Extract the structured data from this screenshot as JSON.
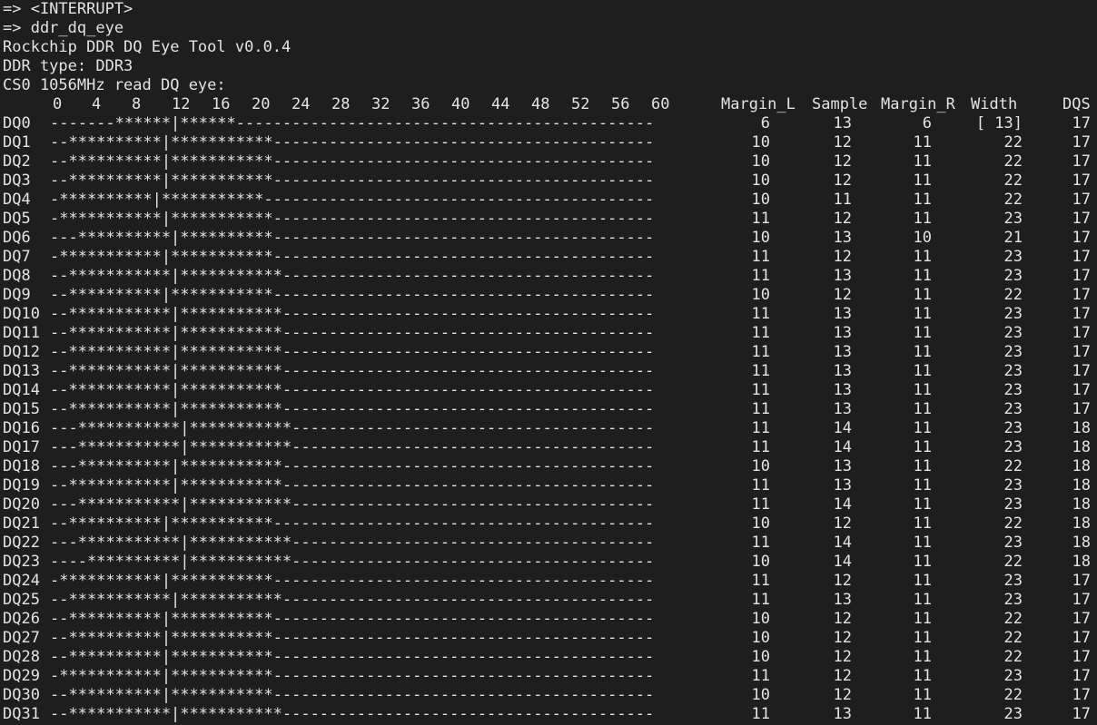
{
  "history": [
    "=> <INTERRUPT>",
    "=> ddr_dq_eye",
    "Rockchip DDR DQ Eye Tool v0.0.4",
    "DDR type: DDR3",
    "CS0 1056MHz read DQ eye:"
  ],
  "scale_ticks": [
    "0",
    "4",
    "8",
    "12",
    "16",
    "20",
    "24",
    "28",
    "32",
    "36",
    "40",
    "44",
    "48",
    "52",
    "56",
    "60"
  ],
  "columns": {
    "margin_l": "Margin_L",
    "sample": "Sample",
    "margin_r": "Margin_R",
    "width": "Width",
    "dqs": "DQS"
  },
  "rows": [
    {
      "name": "DQ0",
      "eye": "-------******|******---------------------------------------------",
      "margin_l": "6",
      "sample": "13",
      "margin_r": "6",
      "width": "[ 13]",
      "dqs": "17"
    },
    {
      "name": "DQ1",
      "eye": "--**********|***********-----------------------------------------",
      "margin_l": "10",
      "sample": "12",
      "margin_r": "11",
      "width": "22",
      "dqs": "17"
    },
    {
      "name": "DQ2",
      "eye": "--**********|***********-----------------------------------------",
      "margin_l": "10",
      "sample": "12",
      "margin_r": "11",
      "width": "22",
      "dqs": "17"
    },
    {
      "name": "DQ3",
      "eye": "--**********|***********-----------------------------------------",
      "margin_l": "10",
      "sample": "12",
      "margin_r": "11",
      "width": "22",
      "dqs": "17"
    },
    {
      "name": "DQ4",
      "eye": "-**********|***********------------------------------------------",
      "margin_l": "10",
      "sample": "11",
      "margin_r": "11",
      "width": "22",
      "dqs": "17"
    },
    {
      "name": "DQ5",
      "eye": "-***********|***********-----------------------------------------",
      "margin_l": "11",
      "sample": "12",
      "margin_r": "11",
      "width": "23",
      "dqs": "17"
    },
    {
      "name": "DQ6",
      "eye": "---**********|**********-----------------------------------------",
      "margin_l": "10",
      "sample": "13",
      "margin_r": "10",
      "width": "21",
      "dqs": "17"
    },
    {
      "name": "DQ7",
      "eye": "-***********|***********-----------------------------------------",
      "margin_l": "11",
      "sample": "12",
      "margin_r": "11",
      "width": "23",
      "dqs": "17"
    },
    {
      "name": "DQ8",
      "eye": "--***********|***********----------------------------------------",
      "margin_l": "11",
      "sample": "13",
      "margin_r": "11",
      "width": "23",
      "dqs": "17"
    },
    {
      "name": "DQ9",
      "eye": "--**********|***********-----------------------------------------",
      "margin_l": "10",
      "sample": "12",
      "margin_r": "11",
      "width": "22",
      "dqs": "17"
    },
    {
      "name": "DQ10",
      "eye": "--***********|***********----------------------------------------",
      "margin_l": "11",
      "sample": "13",
      "margin_r": "11",
      "width": "23",
      "dqs": "17"
    },
    {
      "name": "DQ11",
      "eye": "--***********|***********----------------------------------------",
      "margin_l": "11",
      "sample": "13",
      "margin_r": "11",
      "width": "23",
      "dqs": "17"
    },
    {
      "name": "DQ12",
      "eye": "--***********|***********----------------------------------------",
      "margin_l": "11",
      "sample": "13",
      "margin_r": "11",
      "width": "23",
      "dqs": "17"
    },
    {
      "name": "DQ13",
      "eye": "--***********|***********----------------------------------------",
      "margin_l": "11",
      "sample": "13",
      "margin_r": "11",
      "width": "23",
      "dqs": "17"
    },
    {
      "name": "DQ14",
      "eye": "--***********|***********----------------------------------------",
      "margin_l": "11",
      "sample": "13",
      "margin_r": "11",
      "width": "23",
      "dqs": "17"
    },
    {
      "name": "DQ15",
      "eye": "--***********|***********----------------------------------------",
      "margin_l": "11",
      "sample": "13",
      "margin_r": "11",
      "width": "23",
      "dqs": "17"
    },
    {
      "name": "DQ16",
      "eye": "---***********|***********---------------------------------------",
      "margin_l": "11",
      "sample": "14",
      "margin_r": "11",
      "width": "23",
      "dqs": "18"
    },
    {
      "name": "DQ17",
      "eye": "---***********|***********---------------------------------------",
      "margin_l": "11",
      "sample": "14",
      "margin_r": "11",
      "width": "23",
      "dqs": "18"
    },
    {
      "name": "DQ18",
      "eye": "---**********|***********----------------------------------------",
      "margin_l": "10",
      "sample": "13",
      "margin_r": "11",
      "width": "22",
      "dqs": "18"
    },
    {
      "name": "DQ19",
      "eye": "--***********|***********----------------------------------------",
      "margin_l": "11",
      "sample": "13",
      "margin_r": "11",
      "width": "23",
      "dqs": "18"
    },
    {
      "name": "DQ20",
      "eye": "---***********|***********---------------------------------------",
      "margin_l": "11",
      "sample": "14",
      "margin_r": "11",
      "width": "23",
      "dqs": "18"
    },
    {
      "name": "DQ21",
      "eye": "--**********|***********-----------------------------------------",
      "margin_l": "10",
      "sample": "12",
      "margin_r": "11",
      "width": "22",
      "dqs": "18"
    },
    {
      "name": "DQ22",
      "eye": "---***********|***********---------------------------------------",
      "margin_l": "11",
      "sample": "14",
      "margin_r": "11",
      "width": "23",
      "dqs": "18"
    },
    {
      "name": "DQ23",
      "eye": "----**********|***********---------------------------------------",
      "margin_l": "10",
      "sample": "14",
      "margin_r": "11",
      "width": "22",
      "dqs": "18"
    },
    {
      "name": "DQ24",
      "eye": "-***********|***********-----------------------------------------",
      "margin_l": "11",
      "sample": "12",
      "margin_r": "11",
      "width": "23",
      "dqs": "17"
    },
    {
      "name": "DQ25",
      "eye": "--***********|***********----------------------------------------",
      "margin_l": "11",
      "sample": "13",
      "margin_r": "11",
      "width": "23",
      "dqs": "17"
    },
    {
      "name": "DQ26",
      "eye": "--**********|***********-----------------------------------------",
      "margin_l": "10",
      "sample": "12",
      "margin_r": "11",
      "width": "22",
      "dqs": "17"
    },
    {
      "name": "DQ27",
      "eye": "--**********|***********-----------------------------------------",
      "margin_l": "10",
      "sample": "12",
      "margin_r": "11",
      "width": "22",
      "dqs": "17"
    },
    {
      "name": "DQ28",
      "eye": "--**********|***********-----------------------------------------",
      "margin_l": "10",
      "sample": "12",
      "margin_r": "11",
      "width": "22",
      "dqs": "17"
    },
    {
      "name": "DQ29",
      "eye": "-***********|***********-----------------------------------------",
      "margin_l": "11",
      "sample": "12",
      "margin_r": "11",
      "width": "23",
      "dqs": "17"
    },
    {
      "name": "DQ30",
      "eye": "--**********|***********-----------------------------------------",
      "margin_l": "10",
      "sample": "12",
      "margin_r": "11",
      "width": "22",
      "dqs": "17"
    },
    {
      "name": "DQ31",
      "eye": "--***********|***********----------------------------------------",
      "margin_l": "11",
      "sample": "13",
      "margin_r": "11",
      "width": "23",
      "dqs": "17"
    }
  ],
  "colors": {
    "background": "#1e1e1e",
    "text": "#e3e3e3"
  }
}
